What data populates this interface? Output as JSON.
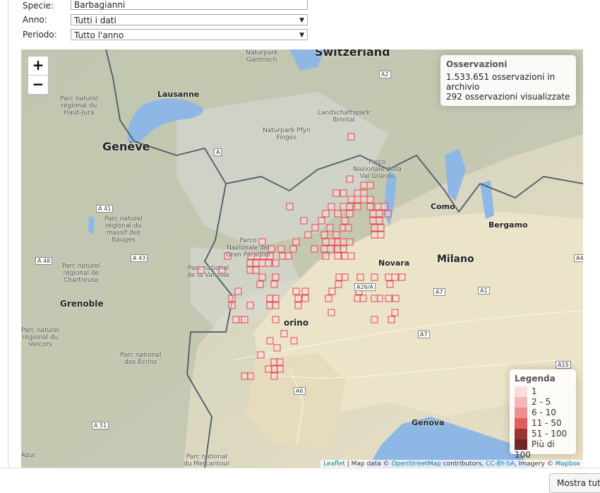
{
  "form": {
    "specie_label": "Specie:",
    "specie_value": "Barbagianni",
    "anno_label": "Anno:",
    "anno_value": "Tutti i dati",
    "periodo_label": "Periodo:",
    "periodo_value": "Tutto l'anno"
  },
  "map": {
    "zoom_in": "+",
    "zoom_out": "−",
    "info": {
      "title": "Osservazioni",
      "line1": "1.533.651 osservazioni in archivio",
      "line2": "292 osservazioni visualizzate"
    },
    "legend": {
      "title": "Legenda",
      "items": [
        {
          "label": "1",
          "color": "#f7dede"
        },
        {
          "label": "2 - 5",
          "color": "#f3b9b9"
        },
        {
          "label": "6 - 10",
          "color": "#ee8f8f"
        },
        {
          "label": "11 - 50",
          "color": "#e35d5d"
        },
        {
          "label": "51 - 100",
          "color": "#9b3434"
        },
        {
          "label": "Più di 100",
          "color": "#6e2828"
        }
      ]
    },
    "attribution": {
      "leaflet": "Leaflet",
      "sep1": " | Map data © ",
      "osm": "OpenStreetMap",
      "sep2": " contributors, ",
      "cc": "CC-BY-SA",
      "sep3": ", Imagery © ",
      "mapbox": "Mapbox"
    },
    "labels": {
      "switzerland": "Switzerland",
      "lausanne": "Lausanne",
      "geneve": "Genève",
      "grenoble": "Grenoble",
      "milano": "Milano",
      "bergamo": "Bergamo",
      "como": "Como",
      "novara": "Novara",
      "torino": "orino",
      "genova": "Genova",
      "gantrisch": "Naturpark\nGantrisch",
      "pfyn": "Naturpark Pfyn\nFinges",
      "binntal": "Landschaftspark\nBinntal",
      "valgrande": "Parco\nNazionale della\nVal Grande",
      "hautjura": "Parc naturel\nrégional du\nHaut-Jura",
      "bauges": "Parc naturel\nrégional du\nmassif des\nBauges",
      "chartreuse": "Parc naturel\nrégional de\nChartreuse",
      "gran_paradiso": "Parco\nNazionale del\nGran Paradiso",
      "vanoise": "Parc national\nde la Vanoise",
      "vercors": "Parc naturel\nrégional du\nVercors",
      "ecrins": "Parc national\ndes Écrins",
      "azur": "Azur",
      "mercantour": "Parc national\ndu Mercantour"
    },
    "roads": {
      "a2": "A2",
      "a41": "A 41",
      "a43": "A 43",
      "a48": "A 48",
      "a51": "A 51",
      "a26": "A26/A",
      "a7": "A7",
      "a7b": "A7",
      "a1": "A1",
      "a4": "A4",
      "a6": "A6",
      "a15": "A15",
      "a": "A"
    },
    "colors": {
      "cell_fill": "#f7dede",
      "cell_stroke": "#e3474b"
    }
  },
  "show_all": "Mostra tutt"
}
